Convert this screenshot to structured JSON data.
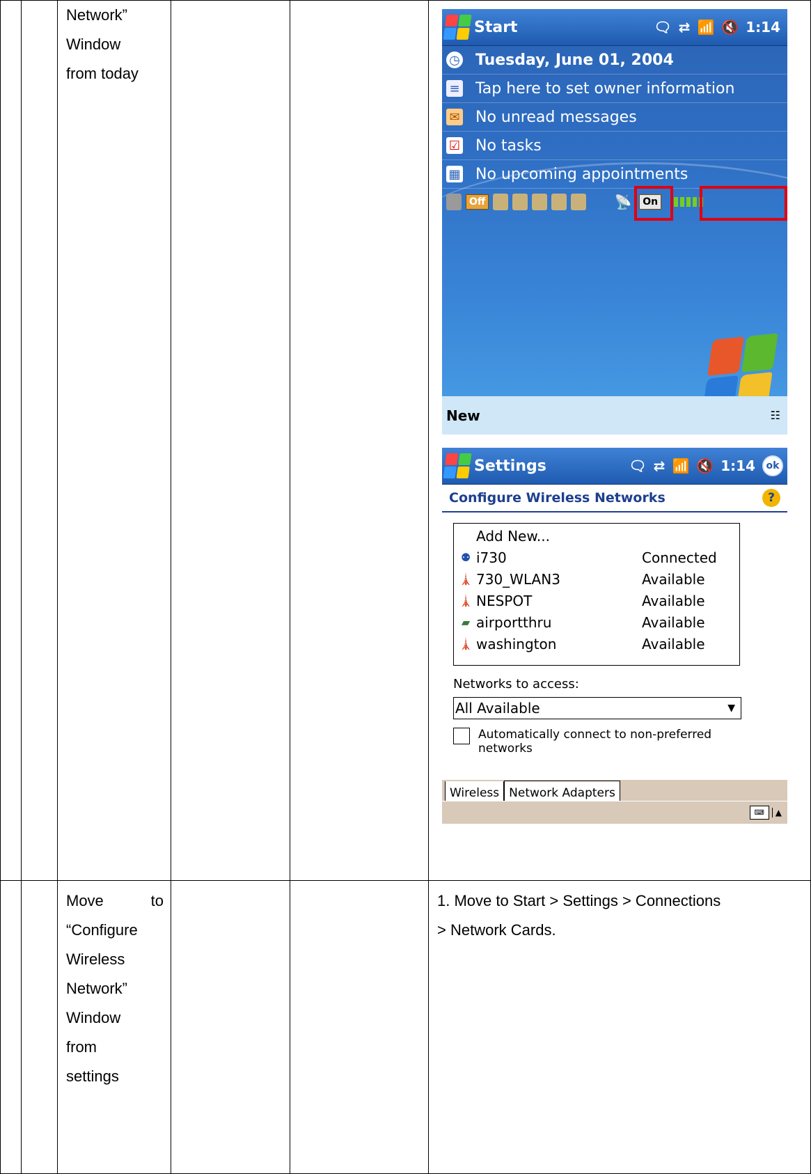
{
  "row1": {
    "step_text_lines": [
      "Network”",
      "Window",
      "from today"
    ]
  },
  "today": {
    "title": "Start",
    "time": "1:14",
    "date": "Tuesday, June 01, 2004",
    "owner": "Tap here to set owner information",
    "messages": "No unread messages",
    "tasks": "No tasks",
    "appointments": "No upcoming appointments",
    "off_label": "Off",
    "on_label": "On",
    "softkey_left": "New",
    "highlight_color": "#e00010"
  },
  "settings": {
    "title": "Settings",
    "time": "1:14",
    "ok_label": "ok",
    "heading": "Configure Wireless Networks",
    "help": "?",
    "add_new": "Add New...",
    "networks": [
      {
        "icon": "connected-antenna-icon",
        "name": "i730",
        "status": "Connected"
      },
      {
        "icon": "access-point-icon",
        "name": "730_WLAN3",
        "status": "Available"
      },
      {
        "icon": "access-point-icon",
        "name": "NESPOT",
        "status": "Available"
      },
      {
        "icon": "adhoc-card-icon",
        "name": "airportthru",
        "status": "Available"
      },
      {
        "icon": "access-point-icon",
        "name": "washington",
        "status": "Available"
      }
    ],
    "access_label": "Networks to access:",
    "access_value": "All Available",
    "auto_connect_line1": "Automatically connect to non-preferred",
    "auto_connect_line2": "networks",
    "tab_wireless": "Wireless",
    "tab_adapters": "Network Adapters"
  },
  "row2": {
    "step_text_lines": [
      "Move",
      "to",
      "“Configure",
      "Wireless",
      "Network”",
      "Window",
      "from",
      "settings"
    ],
    "description_line1": "1. Move to Start > Settings > Connections",
    "description_line2": "> Network Cards."
  }
}
